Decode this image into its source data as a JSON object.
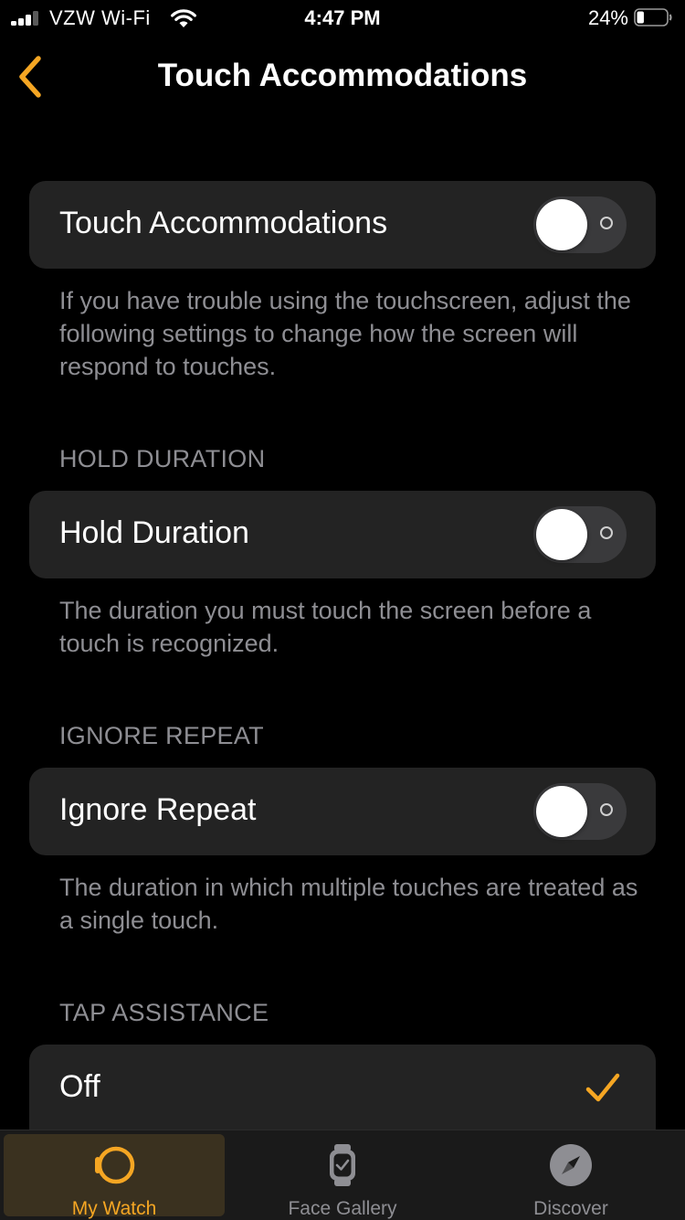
{
  "status": {
    "carrier": "VZW Wi-Fi",
    "time": "4:47 PM",
    "battery_percent": "24%",
    "battery_level": 0.24
  },
  "nav": {
    "title": "Touch Accommodations"
  },
  "sections": [
    {
      "label": "Touch Accommodations",
      "enabled": false,
      "footer": "If you have trouble using the touchscreen, adjust the following settings to change how the screen will respond to touches."
    },
    {
      "header": "HOLD DURATION",
      "label": "Hold Duration",
      "enabled": false,
      "footer": "The duration you must touch the screen before a touch is recognized."
    },
    {
      "header": "IGNORE REPEAT",
      "label": "Ignore Repeat",
      "enabled": false,
      "footer": "The duration in which multiple touches are treated as a single touch."
    },
    {
      "header": "TAP ASSISTANCE",
      "option_label": "Off",
      "selected": true
    }
  ],
  "tabs": [
    {
      "label": "My Watch",
      "icon": "watch-icon",
      "active": true
    },
    {
      "label": "Face Gallery",
      "icon": "face-gallery-icon",
      "active": false
    },
    {
      "label": "Discover",
      "icon": "compass-icon",
      "active": false
    }
  ],
  "colors": {
    "accent": "#f5a623",
    "background": "#000000",
    "cell": "#232323",
    "secondary_text": "#8e8e93",
    "toggle_off": "#3a3a3c"
  }
}
